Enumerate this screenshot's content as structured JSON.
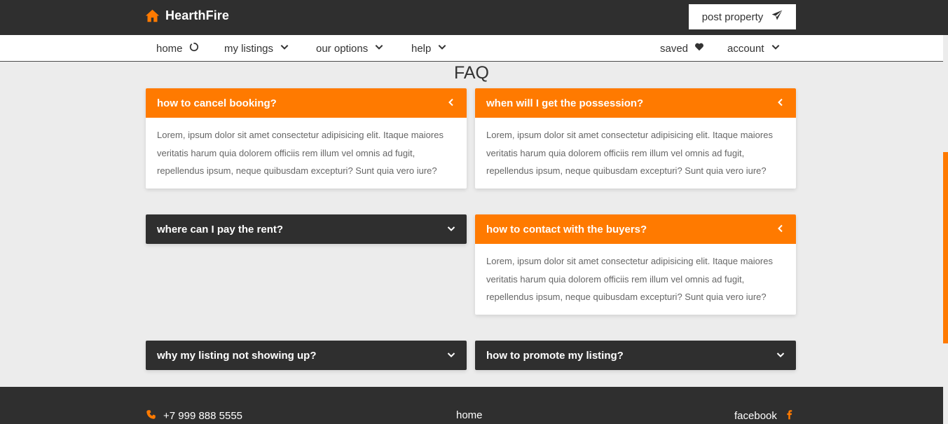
{
  "header": {
    "brand": "HearthFire",
    "post_button": "post property"
  },
  "nav": {
    "home": "home",
    "my_listings": "my listings",
    "our_options": "our options",
    "help": "help",
    "saved": "saved",
    "account": "account"
  },
  "faq_title": "FAQ",
  "faqs": [
    {
      "question": "how to cancel booking?",
      "answer": "Lorem, ipsum dolor sit amet consectetur adipisicing elit. Itaque maiores veritatis harum quia dolorem officiis rem illum vel omnis ad fugit, repellendus ipsum, neque quibusdam excepturi? Sunt quia vero iure?",
      "open": true
    },
    {
      "question": "when will I get the possession?",
      "answer": "Lorem, ipsum dolor sit amet consectetur adipisicing elit. Itaque maiores veritatis harum quia dolorem officiis rem illum vel omnis ad fugit, repellendus ipsum, neque quibusdam excepturi? Sunt quia vero iure?",
      "open": true
    },
    {
      "question": "where can I pay the rent?",
      "open": false
    },
    {
      "question": "how to contact with the buyers?",
      "answer": "Lorem, ipsum dolor sit amet consectetur adipisicing elit. Itaque maiores veritatis harum quia dolorem officiis rem illum vel omnis ad fugit, repellendus ipsum, neque quibusdam excepturi? Sunt quia vero iure?",
      "open": true
    },
    {
      "question": "why my listing not showing up?",
      "open": false
    },
    {
      "question": "how to promote my listing?",
      "open": false
    }
  ],
  "footer": {
    "phone": "+7 999 888 5555",
    "home": "home",
    "facebook": "facebook"
  },
  "colors": {
    "accent": "#ff7a00",
    "dark": "#2f2f2f",
    "background": "#ececec"
  },
  "icons": {
    "brand": "house-icon",
    "post": "paper-plane-icon",
    "home": "circle-notch-icon",
    "dropdown": "chevron-down-icon",
    "saved": "heart-icon",
    "faq_open": "chevron-left-icon",
    "faq_closed": "chevron-down-icon",
    "phone": "phone-icon",
    "facebook": "facebook-f-icon"
  }
}
